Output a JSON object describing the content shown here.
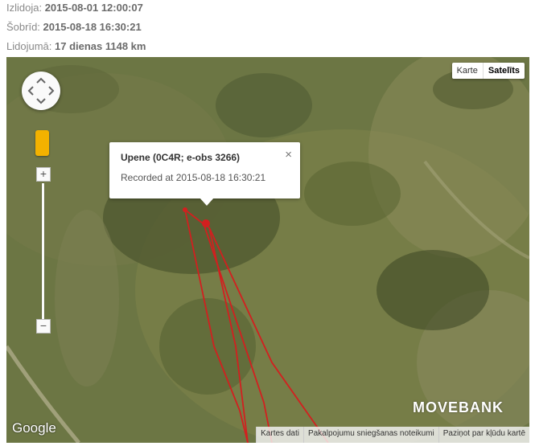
{
  "info": {
    "depart_label": "Izlidoja:",
    "depart_value": "2015-08-01 12:00:07",
    "now_label": "Šobrīd:",
    "now_value": "2015-08-18 16:30:21",
    "flight_label": "Lidojumā:",
    "flight_value": "17 dienas 1148 km"
  },
  "map": {
    "type_buttons": [
      "Karte",
      "Satelīts"
    ],
    "active_type": "Satelīts",
    "zoom_in": "+",
    "zoom_out": "−",
    "popup": {
      "title": "Upene (0C4R; e-obs 3266)",
      "recorded": "Recorded at 2015-08-18 16:30:21",
      "close": "×"
    },
    "brand": "MOVEBANK",
    "google": "Google",
    "footer_links": [
      "Kartes dati",
      "Pakalpojumu sniegšanas noteikumi",
      "Paziņot par kļūdu kartē"
    ],
    "track_color": "#d31f1f"
  }
}
